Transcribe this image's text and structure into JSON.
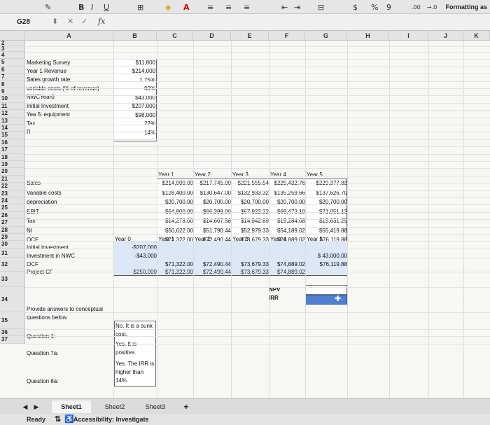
{
  "toolbar": {
    "formatting_label": "Formatting as",
    "icons": [
      "format-painter-icon",
      "bold-icon",
      "italic-icon",
      "underline-icon",
      "borders-icon",
      "fill-color-icon",
      "font-color-icon",
      "align-top-icon",
      "align-middle-icon",
      "align-bottom-icon",
      "decrease-indent-icon",
      "increase-indent-icon",
      "merge-icon",
      "currency-icon",
      "percent-icon",
      "comma-icon",
      "increase-decimal-icon",
      "decrease-decimal-icon"
    ],
    "bold": "B",
    "italic": "I",
    "underline": "U",
    "currency": "$",
    "percent": "%",
    "comma": "9",
    "inc_dec": ".00",
    "dec_dec": "→.0"
  },
  "formula_bar": {
    "cell_ref": "G28",
    "fx": "fx",
    "cancel": "✕",
    "confirm": "✓",
    "value": ""
  },
  "columns": [
    "A",
    "B",
    "C",
    "D",
    "E",
    "F",
    "G",
    "H",
    "I",
    "J",
    "K"
  ],
  "rows": [
    "2",
    "3",
    "4",
    "5",
    "6",
    "7",
    "8",
    "9",
    "10",
    "11",
    "12",
    "13",
    "14",
    "15",
    "16",
    "17",
    "18",
    "19",
    "20",
    "21",
    "22",
    "23",
    "24",
    "25",
    "26",
    "27",
    "28",
    "29",
    "30",
    "31",
    "32",
    "33",
    "34",
    "35",
    "36",
    "37"
  ],
  "inputs": {
    "title": "Marketing Survey",
    "items": [
      {
        "label": "Year 1 Revenue",
        "value": "$11,800"
      },
      {
        "label": "Sales growth rate",
        "value": "$214,000"
      },
      {
        "label": "variable costs (% of revenue)",
        "value": "1.75%"
      },
      {
        "label": "NWCYear0",
        "value": "60%"
      },
      {
        "label": "Initial Investment",
        "value": "$43,000"
      },
      {
        "label": "Yea 5: equipment",
        "value": "$207,000"
      },
      {
        "label": "Tax",
        "value": "$98,000"
      },
      {
        "label": "R",
        "value": "22%"
      },
      {
        "label": "",
        "value": "14%"
      }
    ]
  },
  "ops": {
    "headers": [
      "Year 1",
      "Year 2",
      "Year 3",
      "Year 4",
      "Year 5"
    ],
    "rows": [
      {
        "label": "Sales",
        "values": [
          "$214,000.00",
          "$217,745.00",
          "$221,555.54",
          "$225,432.76",
          "$229,377.83"
        ]
      },
      {
        "label": "Variable costs",
        "values": [
          "$128,400.00",
          "$130,647.00",
          "$132,933.32",
          "$135,259.66",
          "$137,626.70"
        ]
      },
      {
        "label": "depreciation",
        "values": [
          "$20,700.00",
          "$20,700.00",
          "$20,700.00",
          "$20,700.00",
          "$20,700.00"
        ]
      },
      {
        "label": "EBIT",
        "values": [
          "$64,900.00",
          "$66,398.00",
          "$67,922.22",
          "$69,473.10",
          "$71,051.13"
        ]
      },
      {
        "label": "Tax",
        "values": [
          "$14,278.00",
          "$14,607.56",
          "$14,942.89",
          "$15,284.08",
          "$15,631.25"
        ]
      },
      {
        "label": "NI",
        "values": [
          "$50,622.00",
          "$51,790.44",
          "$52,979.33",
          "$54,189.02",
          "$55,419.88"
        ]
      },
      {
        "label": "OCF",
        "values": [
          "$71,322.00",
          "$72,490.44",
          "$73,679.33",
          "$74,889.02",
          "$76,119.88"
        ]
      }
    ]
  },
  "cf": {
    "headers": [
      "Year 0",
      "Year 1",
      "Year 2",
      "Year 3",
      "Year 4",
      "Year 5"
    ],
    "initial_label": "Initial Investment",
    "initial_value": "-$207,000",
    "nwc_label": "Investment in NWC",
    "nwc_value": "-$43,000",
    "nwc_y5": "$ 43,000.00",
    "ocf_label": "OCF",
    "ocf_values": [
      "$71,322.00",
      "$72,490.44",
      "$73,679.33",
      "$74,889.02",
      "$76,119.88"
    ],
    "proj_label": "Project CF",
    "proj_values": [
      "-$250,000",
      "$71,322.00",
      "$72,490.44",
      "$73,679.33",
      "$74,889.02"
    ],
    "npv_label": "NPV",
    "irr_label": "IRR"
  },
  "conceptual": {
    "prompt": [
      "Provide answers to conceptual",
      "questions below"
    ],
    "q1": "Question 1:",
    "a1": [
      "No. It is a sunk",
      "cost."
    ],
    "q2": "Question 7a:",
    "a2": [
      "Yes. It is",
      "positive."
    ],
    "q3": "Question 8a:",
    "a3": [
      "Yes. The IRR is",
      "higher than",
      "14%"
    ]
  },
  "tabs": [
    "Sheet1",
    "Sheet2",
    "Sheet3"
  ],
  "add_sheet": "+",
  "status": {
    "ready": "Ready",
    "accessibility": "Accessibility: Investigate"
  }
}
